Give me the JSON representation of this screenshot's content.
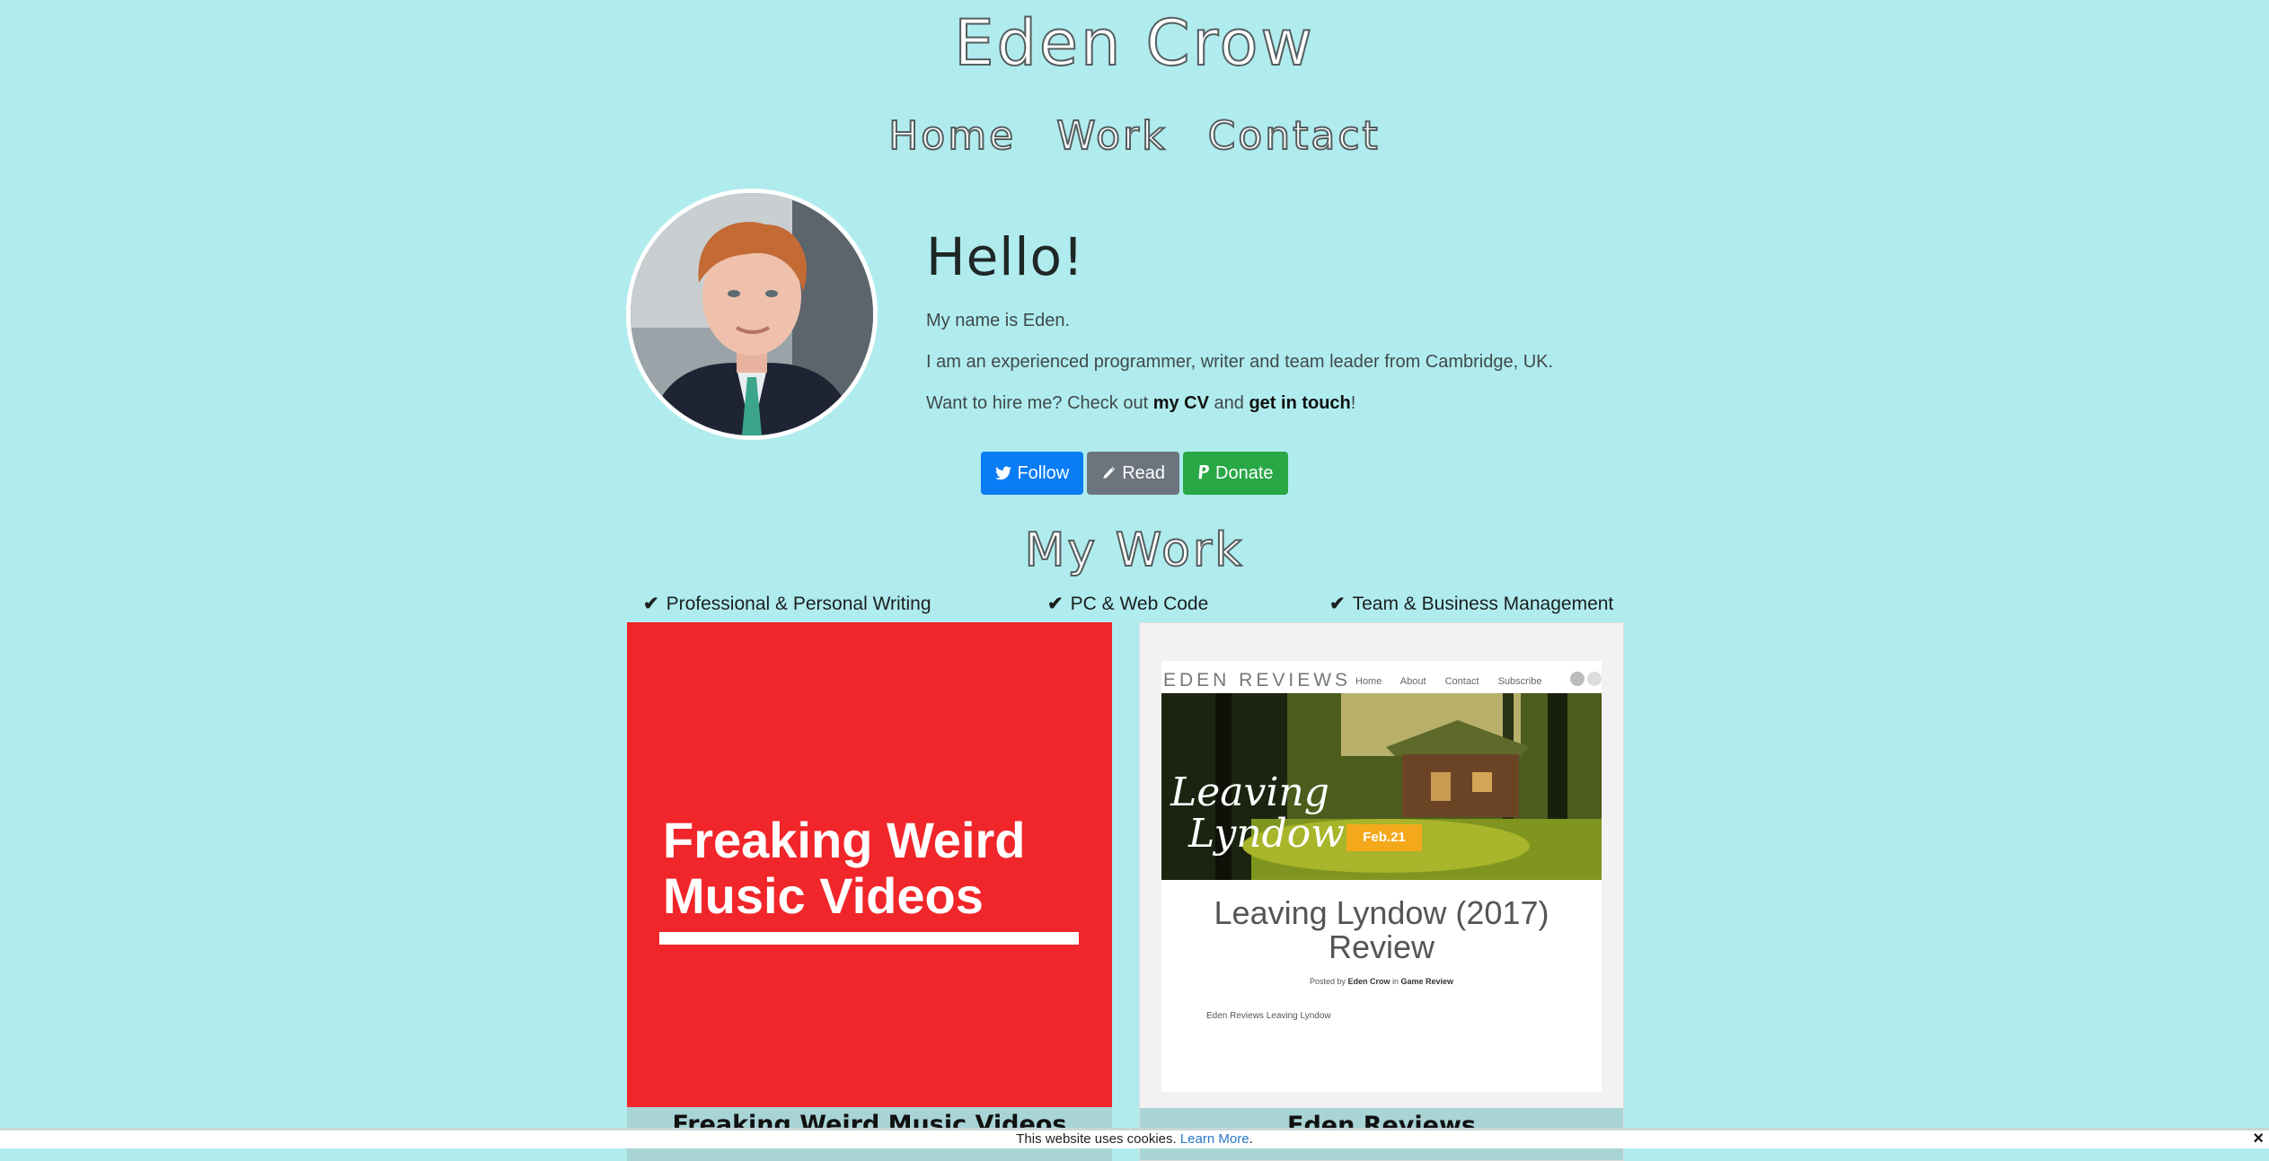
{
  "site": {
    "title": "Eden Crow"
  },
  "nav": {
    "items": [
      {
        "label": "Home"
      },
      {
        "label": "Work"
      },
      {
        "label": "Contact"
      }
    ]
  },
  "intro": {
    "heading": "Hello!",
    "line1": "My name is Eden.",
    "line2": "I am an experienced programmer, writer and team leader from Cambridge, UK.",
    "line3_prefix": "Want to hire me? Check out ",
    "cv_link": "my CV",
    "line3_mid": " and ",
    "contact_link": "get in touch",
    "line3_suffix": "!"
  },
  "buttons": {
    "follow": {
      "label": "Follow",
      "icon": "twitter-icon",
      "color": "#0a7cf5"
    },
    "read": {
      "label": "Read",
      "icon": "pencil-icon",
      "color": "#6c757d"
    },
    "donate": {
      "label": "Donate",
      "icon": "paypal-icon",
      "color": "#28a745"
    }
  },
  "work": {
    "title": "My Work",
    "features": [
      {
        "label": "Professional & Personal Writing"
      },
      {
        "label": "PC & Web Code"
      },
      {
        "label": "Team & Business Management"
      }
    ],
    "cards": [
      {
        "caption": "Freaking Weird Music Videos",
        "thumb_line1": "Freaking Weird",
        "thumb_line2": "Music Videos",
        "color": "#f1262a"
      },
      {
        "caption": "Eden Reviews",
        "thumb": {
          "brand": "EDEN REVIEWS",
          "menu": [
            "Home",
            "About",
            "Contact",
            "Subscribe"
          ],
          "hero_title_line1": "Leaving",
          "hero_title_line2": "Lyndow",
          "date": "Feb.21",
          "post_title_line1": "Leaving Lyndow (2017)",
          "post_title_line2": "Review",
          "meta_prefix": "Posted by ",
          "meta_author": "Eden Crow",
          "meta_mid": " in ",
          "meta_category": "Game Review",
          "excerpt": "Eden Reviews Leaving Lyndow"
        }
      }
    ]
  },
  "cookie": {
    "text": "This website uses cookies. ",
    "link": "Learn More",
    "suffix": ".",
    "close": "×"
  }
}
